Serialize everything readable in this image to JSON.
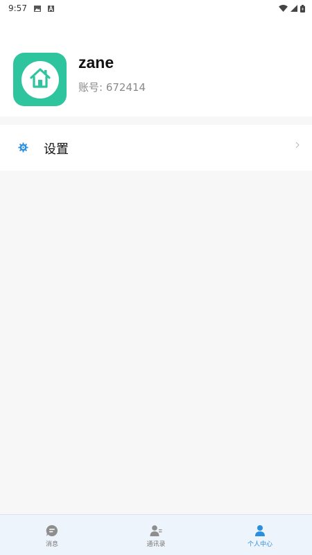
{
  "status_bar": {
    "time": "9:57",
    "icons": [
      "image-icon",
      "text-a-icon",
      "wifi-icon",
      "signal-icon",
      "battery-icon"
    ]
  },
  "profile": {
    "username": "zane",
    "account_label": "账号: ",
    "account_number": "672414",
    "avatar_icon": "home-icon",
    "avatar_color": "#2ec59e"
  },
  "menu": {
    "items": [
      {
        "label": "设置",
        "icon": "gear-icon",
        "trailing": "chevron-right-icon"
      }
    ]
  },
  "bottom_nav": {
    "items": [
      {
        "label": "消息",
        "icon": "chat-icon",
        "active": false
      },
      {
        "label": "通讯录",
        "icon": "contacts-icon",
        "active": false
      },
      {
        "label": "个人中心",
        "icon": "person-icon",
        "active": true
      }
    ],
    "active_color": "#2b8fe0",
    "inactive_color": "#777777"
  }
}
